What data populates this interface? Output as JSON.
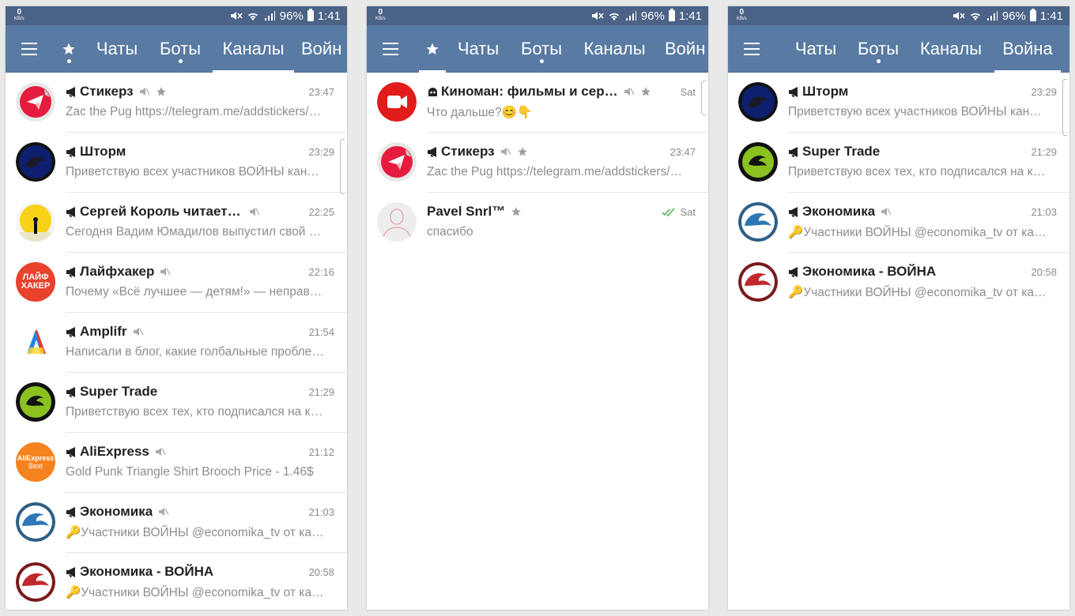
{
  "status_bar": {
    "kb_value": "0",
    "kb_unit": "KB/s",
    "battery": "96%",
    "time": "1:41"
  },
  "panels": [
    {
      "tabs": [
        {
          "label": "",
          "icon": "star-icon",
          "active": false,
          "dot": false
        },
        {
          "label": "Чаты",
          "active": false,
          "dot": false
        },
        {
          "label": "Боты",
          "active": false,
          "dot": true
        },
        {
          "label": "Каналы",
          "active": true,
          "dot": false
        },
        {
          "label": "Войн",
          "active": false,
          "dot": false
        }
      ],
      "chats": [
        {
          "kind": "channel",
          "avatar": "stickers",
          "title": "Стикерз",
          "muted": true,
          "starred": true,
          "time": "23:47",
          "preview": "Zac the Pug https://telegram.me/addstickers/ZacThePug"
        },
        {
          "kind": "channel",
          "avatar": "storm",
          "title": "Шторм",
          "muted": false,
          "starred": false,
          "time": "23:29",
          "preview": "Приветствую всех участников ВОЙНЫ каналов"
        },
        {
          "kind": "channel",
          "avatar": "sunset",
          "title": "Сергей Король читает и пишет",
          "muted": true,
          "starred": false,
          "time": "22:25",
          "preview": "Сегодня Вадим Юмадилов выпустил свой текст"
        },
        {
          "kind": "channel",
          "avatar": "lifehacker",
          "title": "Лайфхакер",
          "muted": true,
          "starred": false,
          "time": "22:16",
          "preview": "Почему «Всё лучшее — детям!» — неправильный принцип"
        },
        {
          "kind": "channel",
          "avatar": "amplifr",
          "title": "Amplifr",
          "muted": true,
          "starred": false,
          "time": "21:54",
          "preview": "Написали в блог, какие голбальные проблемы решаем"
        },
        {
          "kind": "channel",
          "avatar": "supertrade",
          "title": "Super Trade",
          "muted": false,
          "starred": false,
          "time": "21:29",
          "preview": "Приветствую всех тех, кто подписался на канал"
        },
        {
          "kind": "channel",
          "avatar": "aliexpress",
          "title": "AliExpress",
          "muted": true,
          "starred": false,
          "time": "21:12",
          "preview": "Gold Punk Triangle Shirt Brooch Price - 1.46$"
        },
        {
          "kind": "channel",
          "avatar": "economika-blue",
          "title": "Экономика",
          "muted": true,
          "starred": false,
          "time": "21:03",
          "preview": "🔑Участники ВОЙНЫ @economika_tv от канала"
        },
        {
          "kind": "channel",
          "avatar": "economika-red",
          "title": "Экономика - ВОЙНА",
          "muted": false,
          "starred": false,
          "time": "20:58",
          "preview": "🔑Участники ВОЙНЫ @economika_tv от канала"
        }
      ]
    },
    {
      "tabs": [
        {
          "label": "",
          "icon": "star-icon",
          "active": true,
          "dot": false
        },
        {
          "label": "Чаты",
          "active": false,
          "dot": false
        },
        {
          "label": "Боты",
          "active": false,
          "dot": true
        },
        {
          "label": "Каналы",
          "active": false,
          "dot": false
        },
        {
          "label": "Войн",
          "active": false,
          "dot": false
        }
      ],
      "chats": [
        {
          "kind": "bot",
          "avatar": "kinoman",
          "title": "Киноман: фильмы и сериалы",
          "muted": true,
          "starred": true,
          "time": "Sat",
          "preview": "Что дальше?😊👇"
        },
        {
          "kind": "channel",
          "avatar": "stickers",
          "title": "Стикерз",
          "muted": true,
          "starred": true,
          "time": "23:47",
          "preview": "Zac the Pug https://telegram.me/addstickers/ZacThePug"
        },
        {
          "kind": "user",
          "avatar": "pavel",
          "title": "Pavel Snrl™",
          "muted": false,
          "starred": true,
          "time": "Sat",
          "read": true,
          "preview": "спасибо"
        }
      ]
    },
    {
      "tabs": [
        {
          "label": "Чаты",
          "active": false,
          "dot": false
        },
        {
          "label": "Боты",
          "active": false,
          "dot": true
        },
        {
          "label": "Каналы",
          "active": false,
          "dot": false
        },
        {
          "label": "Война",
          "active": true,
          "dot": false
        }
      ],
      "chats": [
        {
          "kind": "channel",
          "avatar": "storm",
          "title": "Шторм",
          "muted": false,
          "starred": false,
          "time": "23:29",
          "preview": "Приветствую всех участников ВОЙНЫ каналов"
        },
        {
          "kind": "channel",
          "avatar": "supertrade",
          "title": "Super Trade",
          "muted": false,
          "starred": false,
          "time": "21:29",
          "preview": "Приветствую всех тех, кто подписался на канал"
        },
        {
          "kind": "channel",
          "avatar": "economika-blue",
          "title": "Экономика",
          "muted": true,
          "starred": false,
          "time": "21:03",
          "preview": "🔑Участники ВОЙНЫ @economika_tv от канала"
        },
        {
          "kind": "channel",
          "avatar": "economika-red",
          "title": "Экономика - ВОЙНА",
          "muted": false,
          "starred": false,
          "time": "20:58",
          "preview": "🔑Участники ВОЙНЫ @economika_tv от канала"
        }
      ]
    }
  ],
  "avatar_text": {
    "lifehacker": [
      "ЛАЙФ",
      "ХАКЕР"
    ],
    "aliexpress": [
      "AliExpress",
      "Best"
    ]
  }
}
